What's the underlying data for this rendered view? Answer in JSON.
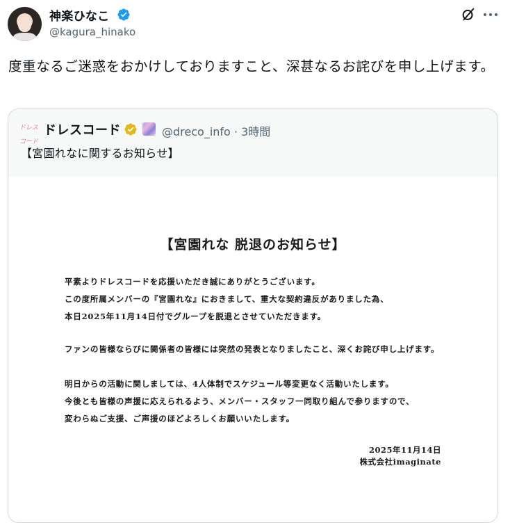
{
  "post": {
    "author": {
      "display_name": "神楽ひなこ",
      "handle": "@kagura_hinako",
      "verified_icon": "blue-verified-badge",
      "avatar_icon": "profile-photo"
    },
    "text": "度重なるご迷惑をおかけしておりますこと、深甚なるお詫びを申し上げます。",
    "actions": {
      "mute_icon": "grok-icon",
      "more_icon": "more-dots-icon"
    }
  },
  "quote": {
    "logo_text": "ドレスコード",
    "author_name": "ドレスコード",
    "verified_icon": "gold-verified-badge",
    "affiliate_icon": "affiliate-badge",
    "handle_time": "@dreco_info · 3時間",
    "text": "【宮園れなに関するお知らせ】",
    "notice": {
      "title": "【宮園れな 脱退のお知らせ】",
      "p1": [
        "平素よりドレスコードを応援いただき誠にありがとうございます。",
        "この度所属メンバーの『宮園れな』におきまして、重大な契約違反がありました為、",
        "本日2025年11月14日付でグループを脱退とさせていただきます。"
      ],
      "p2": [
        "ファンの皆様ならびに関係者の皆様には突然の発表となりましたこと、深くお詫び申し上げます。"
      ],
      "p3": [
        "明日からの活動に関しましては、4人体制でスケジュール等変更なく活動いたします。",
        "今後とも皆様の声援に応えられるよう、メンバー・スタッフ一同取り組んで参りますので、",
        "変わらぬご支援、ご声援のほどよろしくお願いいたします。"
      ],
      "date": "2025年11月14日",
      "company": "株式会社imaginate"
    }
  },
  "colors": {
    "verified_blue": "#1d9bf0",
    "verified_gold": "#e2b719",
    "muted_text": "#536471",
    "border": "#cfd9de"
  }
}
